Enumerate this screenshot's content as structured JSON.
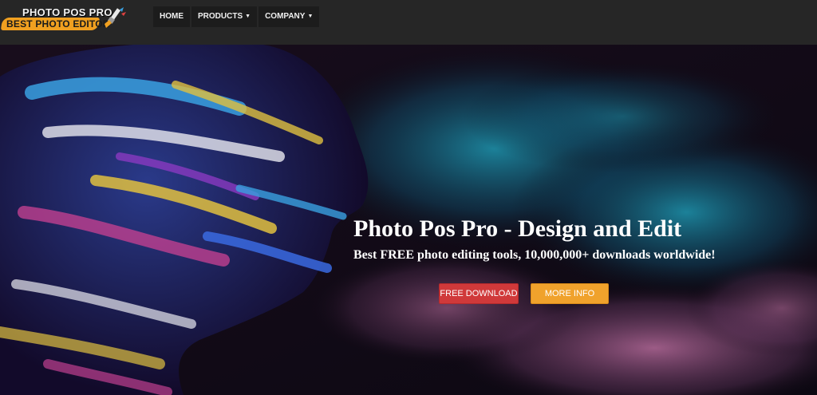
{
  "logo": {
    "line1": "PHOTO POS PRO",
    "line2": "BEST PHOTO EDITOR"
  },
  "nav": {
    "home": "HOME",
    "products": "PRODUCTS",
    "company": "COMPANY"
  },
  "hero": {
    "title": "Photo Pos Pro - Design and Edit",
    "subtitle": "Best FREE photo editing tools, 10,000,000+ downloads worldwide!",
    "free_download_label": "FREE DOWNLOAD",
    "more_info_label": "MORE INFO"
  },
  "colors": {
    "topbar": "#262626",
    "free_download_button": "#d0393a",
    "more_info_button": "#f0a22c",
    "logo_banner": "#f0a020"
  }
}
